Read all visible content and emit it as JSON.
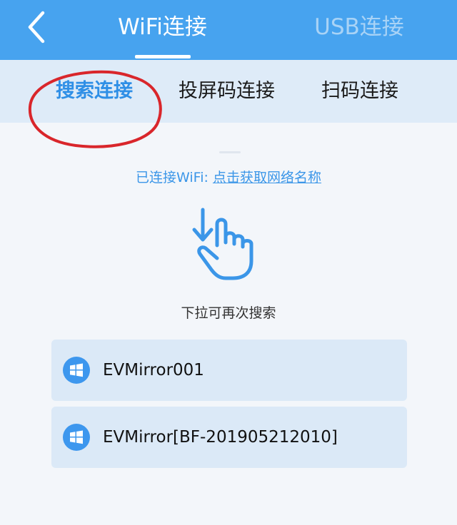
{
  "header": {
    "tabs": [
      {
        "label": "WiFi连接",
        "active": true
      },
      {
        "label": "USB连接",
        "active": false
      }
    ],
    "back_icon": "chevron-left-icon"
  },
  "subtabs": [
    {
      "label": "搜索连接",
      "active": true
    },
    {
      "label": "投屏码连接",
      "active": false
    },
    {
      "label": "扫码连接",
      "active": false
    }
  ],
  "wifi_status": {
    "prefix": "已连接WiFi: ",
    "link": "点击获取网络名称"
  },
  "gesture_icon": "pull-down-hand-icon",
  "pull_hint": "下拉可再次搜索",
  "devices": [
    {
      "name": "EVMirror001",
      "icon": "windows-icon"
    },
    {
      "name": "EVMirror[BF-201905212010]",
      "icon": "windows-icon"
    }
  ],
  "colors": {
    "header_bg": "#47a3ef",
    "subtab_bg": "#deebf8",
    "accent": "#2f8fe6",
    "card_bg": "#dbe9f7",
    "highlight_circle": "#d9262b"
  }
}
